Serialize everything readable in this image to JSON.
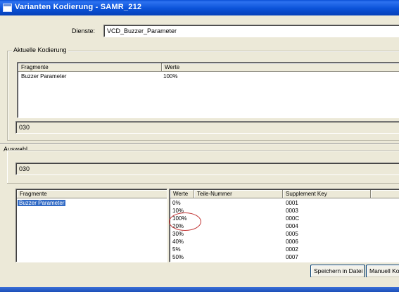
{
  "window": {
    "title": "Varianten Kodierung - SAMR_212"
  },
  "dienste": {
    "label": "Dienste:",
    "value": "VCD_Buzzer_Parameter"
  },
  "aktuelle_kodierung": {
    "legend": "Aktuelle Kodierung",
    "columns": [
      "Fragmente",
      "Werte"
    ],
    "rows": [
      {
        "fragment": "Buzzer Parameter",
        "wert": "100%"
      }
    ],
    "code": "030"
  },
  "auswahl": {
    "legend": "Auswahl",
    "code": "030",
    "fragments_header": "Fragmente",
    "fragments": [
      "Buzzer Parameter"
    ],
    "selected_fragment": "Buzzer Parameter",
    "values_columns": [
      "Werte",
      "Teile-Nummer",
      "Supplement Key"
    ],
    "values_rows": [
      {
        "wert": "0%",
        "teil": "",
        "key": "0001"
      },
      {
        "wert": "10%",
        "teil": "",
        "key": "0003"
      },
      {
        "wert": "100%",
        "teil": "",
        "key": "000C"
      },
      {
        "wert": "20%",
        "teil": "",
        "key": "0004"
      },
      {
        "wert": "30%",
        "teil": "",
        "key": "0005"
      },
      {
        "wert": "40%",
        "teil": "",
        "key": "0006"
      },
      {
        "wert": "5%",
        "teil": "",
        "key": "0002"
      },
      {
        "wert": "50%",
        "teil": "",
        "key": "0007"
      }
    ],
    "highlighted_value": "100%"
  },
  "buttons": {
    "save": "Speichern in Datei",
    "manual": "Manuell Ko"
  },
  "colors": {
    "titlebar": "#0b52d8",
    "selection": "#316ac5",
    "annotation": "#c03030"
  }
}
